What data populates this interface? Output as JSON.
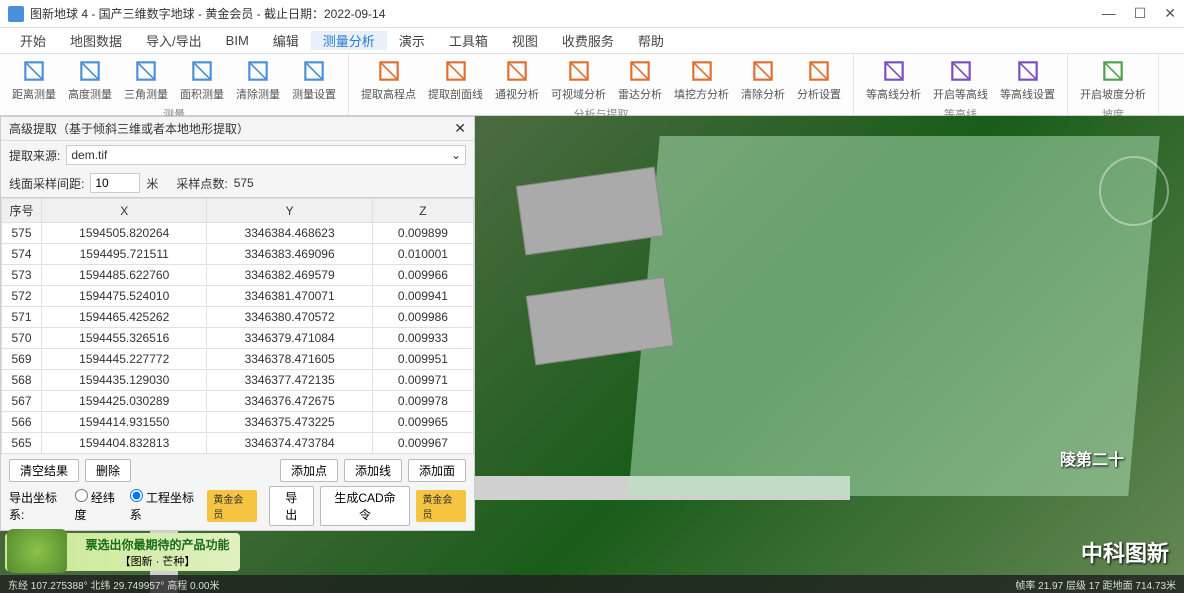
{
  "titlebar": {
    "text": "图新地球 4 - 国产三维数字地球 - 黄金会员 - 截止日期：2022-09-14"
  },
  "menu": {
    "items": [
      "开始",
      "地图数据",
      "导入/导出",
      "BIM",
      "编辑",
      "测量分析",
      "演示",
      "工具箱",
      "视图",
      "收费服务",
      "帮助"
    ],
    "active_index": 5
  },
  "ribbon": {
    "groups": [
      {
        "label": "测量",
        "tools": [
          "距离测量",
          "高度测量",
          "三角测量",
          "面积测量",
          "清除测量",
          "测量设置"
        ]
      },
      {
        "label": "分析与提取",
        "tools": [
          "提取高程点",
          "提取剖面线",
          "通视分析",
          "可视域分析",
          "雷达分析",
          "填挖方分析",
          "清除分析",
          "分析设置"
        ]
      },
      {
        "label": "等高线",
        "tools": [
          "等高线分析",
          "开启等高线",
          "等高线设置"
        ]
      },
      {
        "label": "坡度",
        "tools": [
          "开启坡度分析"
        ]
      }
    ]
  },
  "panel": {
    "title": "高级提取（基于倾斜三维或者本地地形提取）",
    "source_label": "提取来源:",
    "source_value": "dem.tif",
    "interval_label": "线面采样间距:",
    "interval_value": "10",
    "interval_unit": "米",
    "sample_label": "采样点数:",
    "sample_value": "575",
    "columns": [
      "序号",
      "X",
      "Y",
      "Z"
    ],
    "rows": [
      [
        "575",
        "1594505.820264",
        "3346384.468623",
        "0.009899"
      ],
      [
        "574",
        "1594495.721511",
        "3346383.469096",
        "0.010001"
      ],
      [
        "573",
        "1594485.622760",
        "3346382.469579",
        "0.009966"
      ],
      [
        "572",
        "1594475.524010",
        "3346381.470071",
        "0.009941"
      ],
      [
        "571",
        "1594465.425262",
        "3346380.470572",
        "0.009986"
      ],
      [
        "570",
        "1594455.326516",
        "3346379.471084",
        "0.009933"
      ],
      [
        "569",
        "1594445.227772",
        "3346378.471605",
        "0.009951"
      ],
      [
        "568",
        "1594435.129030",
        "3346377.472135",
        "0.009971"
      ],
      [
        "567",
        "1594425.030289",
        "3346376.472675",
        "0.009978"
      ],
      [
        "566",
        "1594414.931550",
        "3346375.473225",
        "0.009965"
      ],
      [
        "565",
        "1594404.832813",
        "3346374.473784",
        "0.009967"
      ]
    ],
    "footer": {
      "clear_btn": "清空结果",
      "delete_btn": "删除",
      "add_point": "添加点",
      "add_line": "添加线",
      "add_face": "添加面",
      "coord_label": "导出坐标系:",
      "coord_opt1": "经纬度",
      "coord_opt2": "工程坐标系",
      "badge": "黄金会员",
      "export_btn": "导出",
      "cad_btn": "生成CAD命令"
    }
  },
  "promo": {
    "line1": "票选出你最期待的产品功能",
    "line2": "【图新 · 芒种】"
  },
  "statusbar": {
    "left": "东经 107.275388° 北纬 29.749957° 高程 0.00米",
    "right": "帧率 21.97  层级 17  距地面 714.73米"
  },
  "logo": "中科图新",
  "map_text1": "陵第二十"
}
